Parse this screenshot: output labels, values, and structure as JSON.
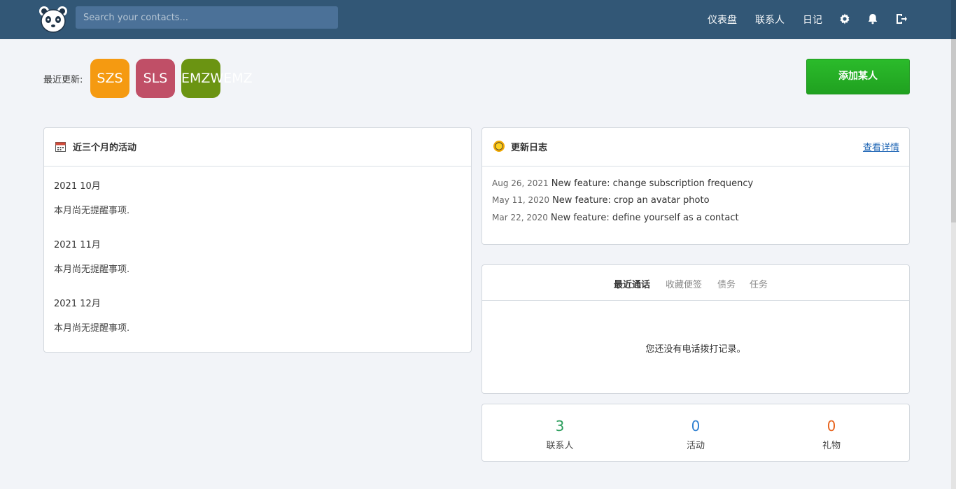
{
  "search": {
    "placeholder": "Search your contacts..."
  },
  "nav": {
    "dashboard": "仪表盘",
    "contacts": "联系人",
    "journal": "日记"
  },
  "recent": {
    "label": "最近更新:",
    "avatars": [
      {
        "initials": "SZS",
        "color": "#f59a11"
      },
      {
        "initials": "SLS",
        "color": "#c04f67"
      },
      {
        "initials": "EMZWEMZ",
        "color": "#6b9412"
      }
    ]
  },
  "add_button": "添加某人",
  "activity": {
    "title": "近三个月的活动",
    "months": [
      {
        "month": "2021 10月",
        "text": "本月尚无提醒事项."
      },
      {
        "month": "2021 11月",
        "text": "本月尚无提醒事项."
      },
      {
        "month": "2021 12月",
        "text": "本月尚无提醒事项."
      }
    ]
  },
  "changelog": {
    "title": "更新日志",
    "link": "查看详情",
    "entries": [
      {
        "date": "Aug 26, 2021",
        "text": "New feature: change subscription frequency"
      },
      {
        "date": "May 11, 2020",
        "text": "New feature: crop an avatar photo"
      },
      {
        "date": "Mar 22, 2020",
        "text": "New feature: define yourself as a contact"
      }
    ]
  },
  "tabs": {
    "items": [
      "最近通话",
      "收藏便签",
      "债务",
      "任务"
    ],
    "active": "最近通话",
    "empty": "您还没有电话拨打记录。"
  },
  "stats": [
    {
      "value": "3",
      "label": "联系人",
      "color": "#2a9d5b"
    },
    {
      "value": "0",
      "label": "活动",
      "color": "#2f80d1"
    },
    {
      "value": "0",
      "label": "礼物",
      "color": "#e8641e"
    }
  ]
}
